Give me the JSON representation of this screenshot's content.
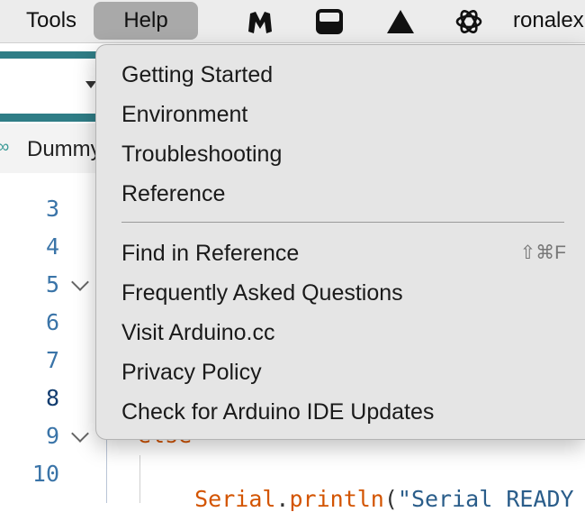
{
  "menubar": {
    "items": [
      {
        "label": "Tools"
      },
      {
        "label": "Help"
      }
    ],
    "tray_icons": [
      "malwarebytes-icon",
      "display-icon",
      "vercel-triangle-icon",
      "openai-icon"
    ],
    "user_name": "ronalex"
  },
  "editor": {
    "tab_label": "Dummy",
    "line_numbers": [
      "3",
      "4",
      "5",
      "6",
      "7",
      "8",
      "9",
      "10"
    ],
    "current_line": "8",
    "code_else": "else",
    "code_serial": "Serial",
    "code_dot": ".",
    "code_println": "println",
    "code_paren": "(",
    "code_string": "\"Serial READY"
  },
  "help_menu": {
    "items": [
      {
        "label": "Getting Started"
      },
      {
        "label": "Environment"
      },
      {
        "label": "Troubleshooting"
      },
      {
        "label": "Reference"
      },
      {
        "label": "Find in Reference",
        "shortcut": "⇧⌘F"
      },
      {
        "label": "Frequently Asked Questions"
      },
      {
        "label": "Visit Arduino.cc"
      },
      {
        "label": "Privacy Policy"
      },
      {
        "label": "Check for Arduino IDE Updates"
      }
    ]
  },
  "colors": {
    "menu_background": "#e5e5e5",
    "active_menubar_item": "#a9a9a9",
    "teal_accent": "#2f7d86",
    "line_number": "#3a74a8",
    "keyword_orange": "#d35400"
  }
}
